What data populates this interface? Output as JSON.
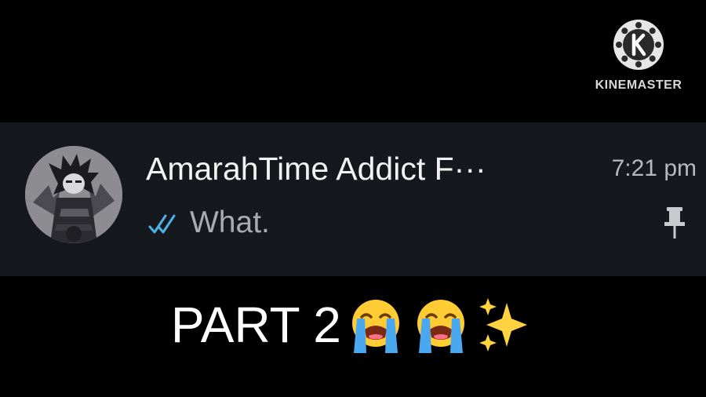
{
  "watermark": {
    "brand": "KINEMASTER",
    "icon": "kinemaster-logo-icon"
  },
  "chat": {
    "contact_name": "AmarahTime Addict F···",
    "time": "7:21 pm",
    "last_message": "What.",
    "status_icon": "double-check-read-icon",
    "pinned": true,
    "pin_icon": "pin-icon",
    "avatar_icon": "anime-avatar-icon",
    "colors": {
      "row_background": "#15191d",
      "name": "#f2f2f2",
      "message": "#a8acb1",
      "read_ticks": "#4fb0e8"
    }
  },
  "caption": {
    "text": "PART 2",
    "emojis": [
      "loudly-crying-face-icon",
      "loudly-crying-face-icon",
      "sparkles-icon"
    ]
  }
}
